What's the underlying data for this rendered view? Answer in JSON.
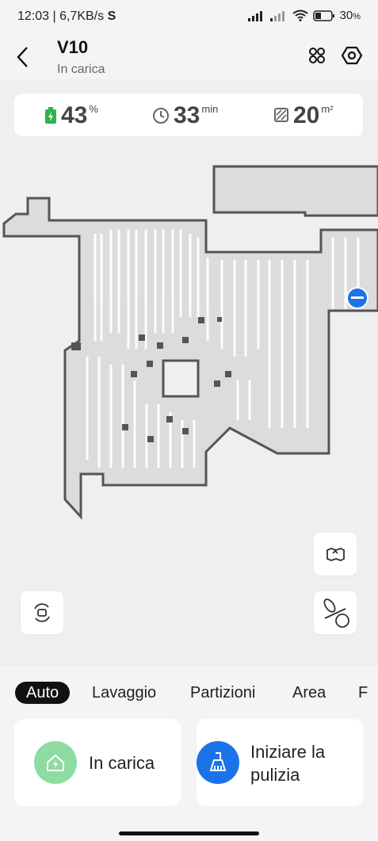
{
  "status_bar": {
    "time_speed": "12:03 | 6,7KB/s",
    "carrier_glyph": "S",
    "battery_percent": "30",
    "battery_unit": "%"
  },
  "header": {
    "title": "V10",
    "subtitle": "In carica",
    "icons": [
      "back-arrow-icon",
      "grid-icon",
      "settings-hex-icon"
    ]
  },
  "stats": {
    "battery": {
      "value": "43",
      "unit": "%",
      "icon": "battery-charging-icon"
    },
    "time": {
      "value": "33",
      "unit": "min",
      "icon": "clock-icon"
    },
    "area": {
      "value": "20",
      "unit": "m²",
      "icon": "area-icon"
    }
  },
  "map": {
    "buttons": [
      "map-edit-icon",
      "reset-view-icon",
      "toggle-path-icon"
    ]
  },
  "tabs": [
    "Auto",
    "Lavaggio",
    "Partizioni",
    "Area",
    "F"
  ],
  "selected_tab": "Auto",
  "actions": {
    "charging": {
      "label": "In carica",
      "icon": "home-charge-icon"
    },
    "start": {
      "label_line1": "Iniziare la",
      "label_line2": "pulizia",
      "icon": "broom-icon"
    }
  },
  "colors": {
    "accent": "#1a73e8",
    "charging": "#8fdca0",
    "battery_green": "#2db54a"
  }
}
